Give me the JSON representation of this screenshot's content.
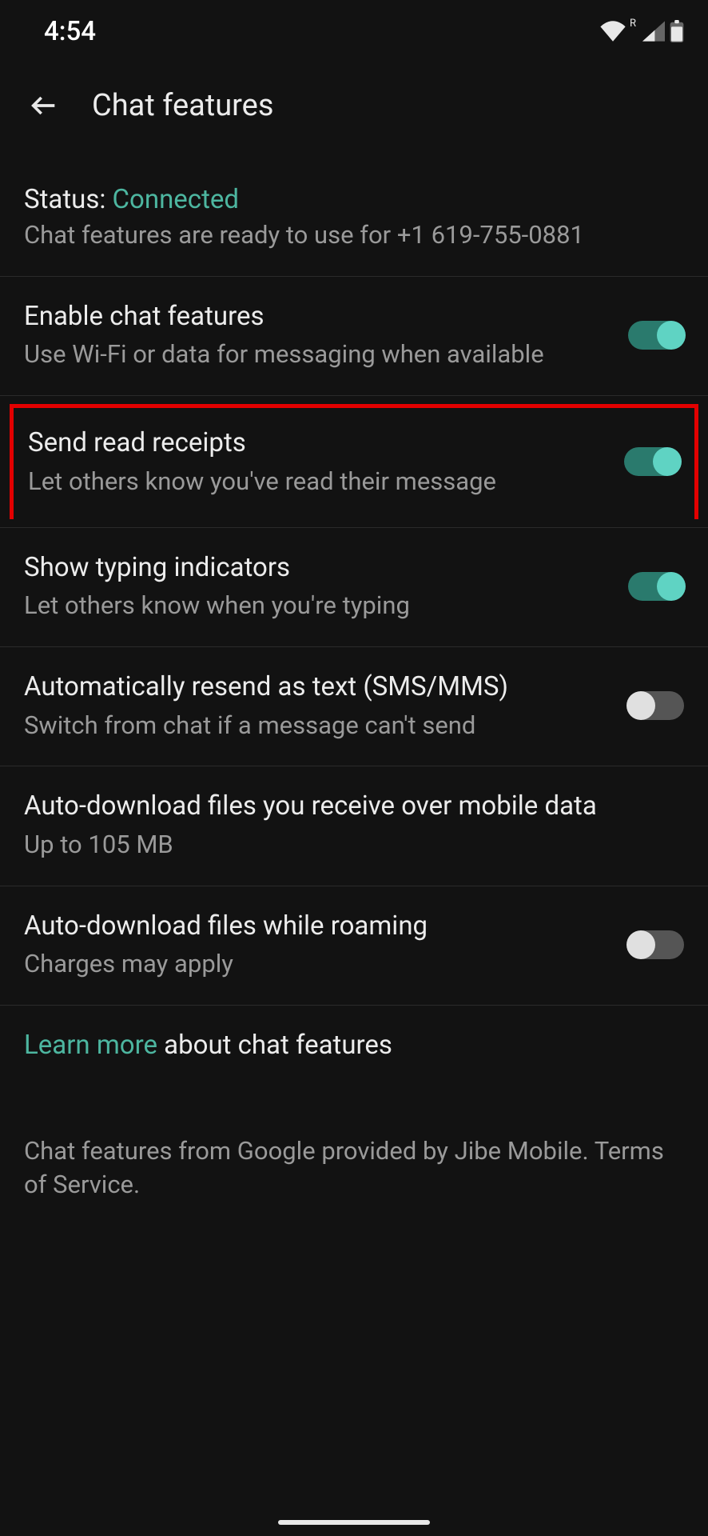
{
  "statusbar": {
    "time": "4:54",
    "roaming_indicator": "R"
  },
  "appbar": {
    "title": "Chat features"
  },
  "status": {
    "label": "Status: ",
    "value": "Connected",
    "sub": "Chat features are ready to use for +1 619-755-0881"
  },
  "settings": {
    "enable": {
      "title": "Enable chat features",
      "sub": "Use Wi-Fi or data for messaging when available",
      "on": true
    },
    "read_receipts": {
      "title": "Send read receipts",
      "sub": "Let others know you've read their message",
      "on": true
    },
    "typing": {
      "title": "Show typing indicators",
      "sub": "Let others know when you're typing",
      "on": true
    },
    "auto_resend": {
      "title": "Automatically resend as text (SMS/MMS)",
      "sub": "Switch from chat if a message can't send",
      "on": false
    },
    "auto_download_mobile": {
      "title": "Auto-download files you receive over mobile data",
      "sub": "Up to 105 MB"
    },
    "auto_download_roaming": {
      "title": "Auto-download files while roaming",
      "sub": "Charges may apply",
      "on": false
    }
  },
  "footer": {
    "learn_more": "Learn more",
    "about": " about chat features",
    "provider": "Chat features from Google provided by Jibe Mobile. Terms of Service."
  }
}
